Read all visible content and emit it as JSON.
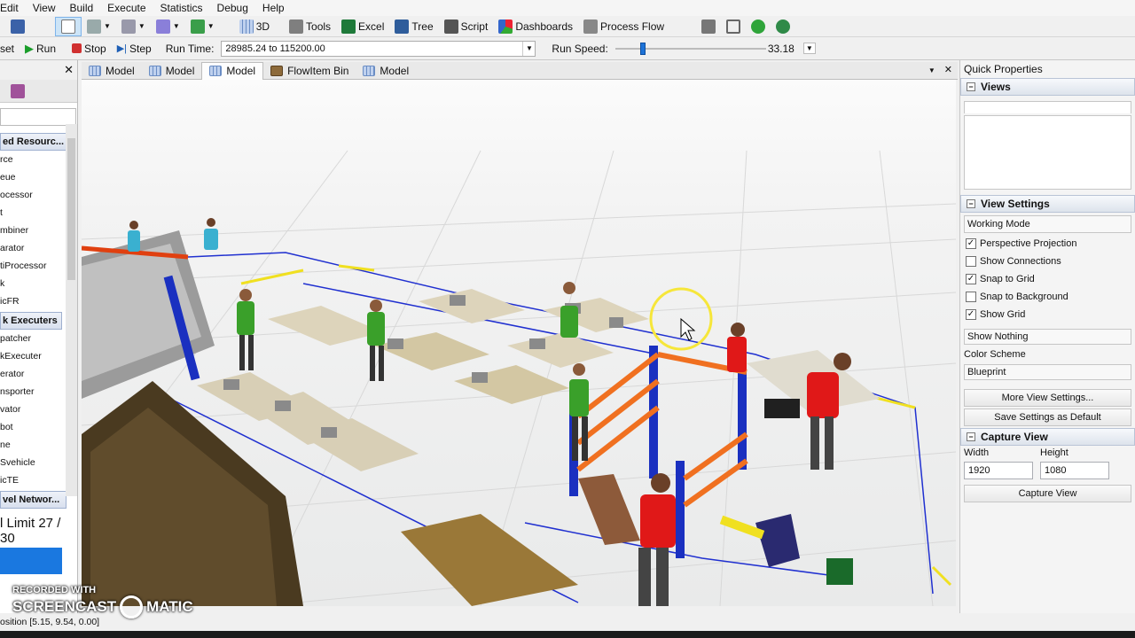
{
  "menu": [
    "Edit",
    "View",
    "Build",
    "Execute",
    "Statistics",
    "Debug",
    "Help"
  ],
  "toolbar": {
    "btn_3d": "3D",
    "btn_tools": "Tools",
    "btn_excel": "Excel",
    "btn_tree": "Tree",
    "btn_script": "Script",
    "btn_dashboards": "Dashboards",
    "btn_processflow": "Process Flow"
  },
  "runbar": {
    "reset": "set",
    "run": "Run",
    "stop": "Stop",
    "step": "Step",
    "runtime_label": "Run Time:",
    "runtime_value": "28985.24  to  115200.00",
    "speed_label": "Run Speed:",
    "speed_value": "33.18"
  },
  "library": {
    "group1": "ed Resourc...",
    "items1": [
      "rce",
      "eue",
      "ocessor",
      "t",
      "mbiner",
      "arator",
      "tiProcessor",
      "k",
      "icFR"
    ],
    "group2": "k Executers",
    "items2": [
      "patcher",
      "kExecuter",
      "erator",
      "nsporter",
      "vator",
      "bot",
      "ne",
      "Svehicle",
      "icTE"
    ],
    "group3": "vel Networ...",
    "limit": "l Limit",
    "limit_count": "27 / 30"
  },
  "tabs": [
    "Model",
    "Model",
    "Model",
    "FlowItem Bin",
    "Model"
  ],
  "quick": {
    "title": "Quick Properties",
    "views": "Views",
    "view_settings": "View Settings",
    "working_mode": "Working Mode",
    "checks": [
      {
        "label": "Perspective Projection",
        "checked": "✓"
      },
      {
        "label": "Show Connections",
        "checked": ""
      },
      {
        "label": "Snap to Grid",
        "checked": "✓"
      },
      {
        "label": "Snap to Background",
        "checked": ""
      },
      {
        "label": "Show Grid",
        "checked": "✓"
      }
    ],
    "show_nothing": "Show Nothing",
    "color_scheme_label": "Color Scheme",
    "color_scheme": "Blueprint",
    "more_settings": "More View Settings...",
    "save_default": "Save Settings as Default",
    "capture_view": "Capture View",
    "width_label": "Width",
    "height_label": "Height",
    "width": "1920",
    "height": "1080",
    "capture_btn": "Capture View"
  },
  "status": {
    "position": "osition [5.15, 9.54, 0.00]"
  },
  "watermark": {
    "line1": "RECORDED WITH",
    "line2a": "SCREENCAST",
    "line2b": "MATIC"
  }
}
